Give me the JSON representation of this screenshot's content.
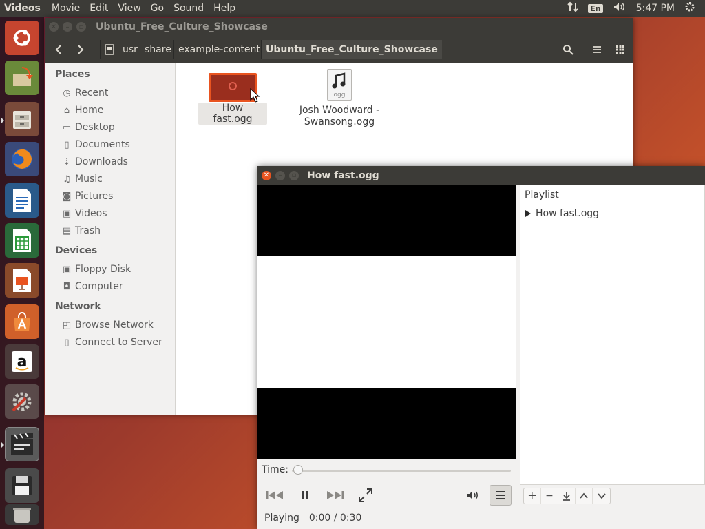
{
  "top_panel": {
    "app_name": "Videos",
    "menus": [
      "Movie",
      "Edit",
      "View",
      "Go",
      "Sound",
      "Help"
    ],
    "keyboard_layout": "En",
    "clock": "5:47 PM"
  },
  "files_window": {
    "title": "Ubuntu_Free_Culture_Showcase",
    "breadcrumbs": [
      "usr",
      "share",
      "example-content",
      "Ubuntu_Free_Culture_Showcase"
    ],
    "sidebar": {
      "places_heading": "Places",
      "places": [
        "Recent",
        "Home",
        "Desktop",
        "Documents",
        "Downloads",
        "Music",
        "Pictures",
        "Videos",
        "Trash"
      ],
      "devices_heading": "Devices",
      "devices": [
        "Floppy Disk",
        "Computer"
      ],
      "network_heading": "Network",
      "network": [
        "Browse Network",
        "Connect to Server"
      ]
    },
    "files": [
      {
        "name": "How fast.ogg",
        "selected": true
      },
      {
        "name": "Josh Woodward - Swansong.ogg",
        "icon_label": "ogg",
        "selected": false
      }
    ]
  },
  "video_window": {
    "title": "How fast.ogg",
    "playlist": {
      "header": "Playlist",
      "items": [
        "How fast.ogg"
      ]
    },
    "time_label": "Time:",
    "status": "Playing",
    "time_display": "0:00 / 0:30",
    "progress": 0.0
  },
  "colors": {
    "accent": "#e95420",
    "panel": "#3c3b37"
  }
}
